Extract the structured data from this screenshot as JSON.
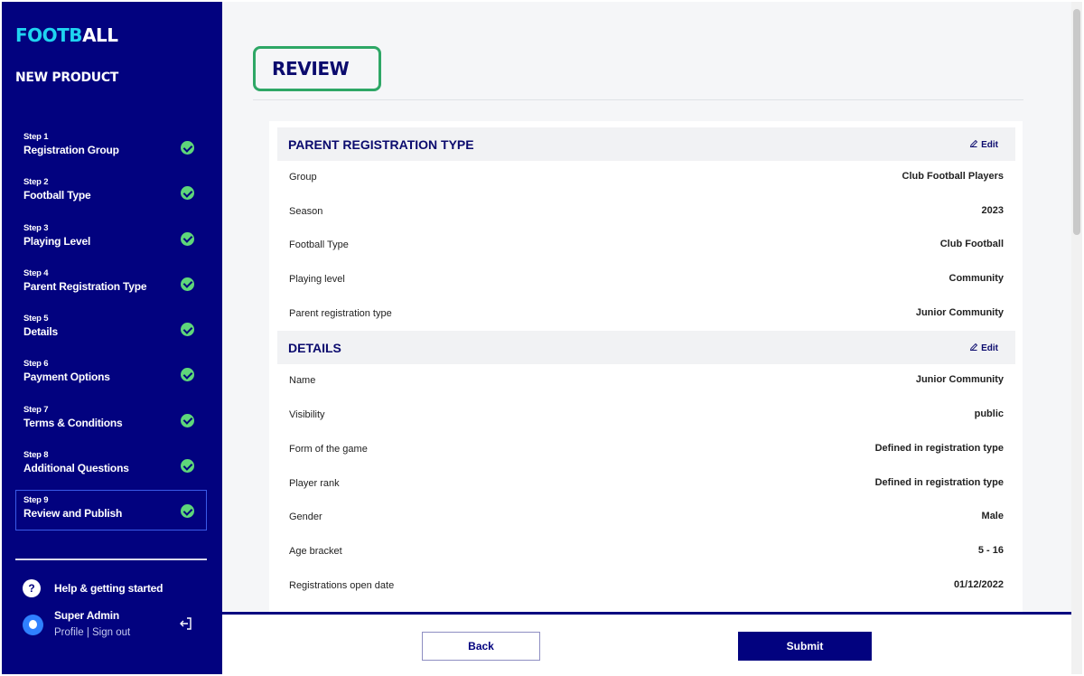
{
  "app": {
    "logo_part1": "FOOTB",
    "logo_part2": "ALL",
    "product_title": "NEW PRODUCT"
  },
  "steps": [
    {
      "num": "Step 1",
      "label": "Registration Group",
      "completed": true
    },
    {
      "num": "Step 2",
      "label": "Football Type",
      "completed": true
    },
    {
      "num": "Step 3",
      "label": "Playing Level",
      "completed": true
    },
    {
      "num": "Step 4",
      "label": "Parent Registration Type",
      "completed": true
    },
    {
      "num": "Step 5",
      "label": "Details",
      "completed": true
    },
    {
      "num": "Step 6",
      "label": "Payment Options",
      "completed": true
    },
    {
      "num": "Step 7",
      "label": "Terms & Conditions",
      "completed": true
    },
    {
      "num": "Step 8",
      "label": "Additional Questions",
      "completed": true
    },
    {
      "num": "Step 9",
      "label": "Review and Publish",
      "completed": true,
      "active": true
    }
  ],
  "help": {
    "icon_text": "?",
    "label": "Help & getting started"
  },
  "user": {
    "name": "Super Admin",
    "profile_label": "Profile",
    "separator": "|",
    "signout_label": "Sign out"
  },
  "page": {
    "title": "REVIEW"
  },
  "sections": [
    {
      "title": "PARENT REGISTRATION TYPE",
      "edit_label": "Edit",
      "rows": [
        {
          "key": "Group",
          "value": "Club Football Players"
        },
        {
          "key": "Season",
          "value": "2023"
        },
        {
          "key": "Football Type",
          "value": "Club Football"
        },
        {
          "key": "Playing level",
          "value": "Community"
        },
        {
          "key": "Parent registration type",
          "value": "Junior Community"
        }
      ]
    },
    {
      "title": "DETAILS",
      "edit_label": "Edit",
      "rows": [
        {
          "key": "Name",
          "value": "Junior Community"
        },
        {
          "key": "Visibility",
          "value": "public"
        },
        {
          "key": "Form of the game",
          "value": "Defined in registration type"
        },
        {
          "key": "Player rank",
          "value": "Defined in registration type"
        },
        {
          "key": "Gender",
          "value": "Male"
        },
        {
          "key": "Age bracket",
          "value": "5 - 16"
        },
        {
          "key": "Registrations open date",
          "value": "01/12/2022"
        }
      ]
    }
  ],
  "footer": {
    "back_label": "Back",
    "submit_label": "Submit"
  },
  "colors": {
    "sidebar": "#02027f",
    "accent_cyan": "#1fd4f0",
    "check_green": "#5ed67a",
    "highlight_green": "#2ea766"
  }
}
